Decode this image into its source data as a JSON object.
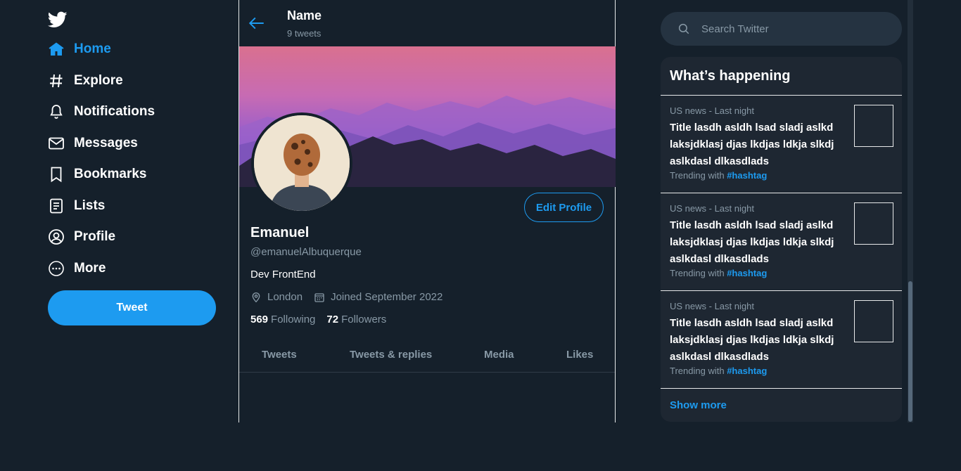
{
  "nav": {
    "items": [
      {
        "label": "Home",
        "icon": "home-icon"
      },
      {
        "label": "Explore",
        "icon": "hashtag-icon"
      },
      {
        "label": "Notifications",
        "icon": "bell-icon"
      },
      {
        "label": "Messages",
        "icon": "envelope-icon"
      },
      {
        "label": "Bookmarks",
        "icon": "bookmark-icon"
      },
      {
        "label": "Lists",
        "icon": "list-icon"
      },
      {
        "label": "Profile",
        "icon": "user-icon"
      },
      {
        "label": "More",
        "icon": "more-icon"
      }
    ],
    "tweet_button": "Tweet"
  },
  "header": {
    "name": "Name",
    "tweet_count": "9 tweets"
  },
  "profile": {
    "display_name": "Emanuel",
    "handle": "@emanuelAlbuquerque",
    "bio": "Dev FrontEnd",
    "location": "London",
    "joined": "Joined September 2022",
    "following_count": "569",
    "following_label": "Following",
    "followers_count": "72",
    "followers_label": "Followers",
    "edit_button": "Edit Profile"
  },
  "tabs": [
    "Tweets",
    "Tweets & replies",
    "Media",
    "Likes"
  ],
  "search": {
    "placeholder": "Search Twitter"
  },
  "trends": {
    "title": "What’s happening",
    "items": [
      {
        "meta": "US news - Last night",
        "title": "Title lasdh asldh lsad sladj aslkd laksjdklasj djas lkdjas ldkja slkdj aslkdasl dlkasdlads",
        "trending_with": "Trending with",
        "hashtag": "#hashtag"
      },
      {
        "meta": "US news - Last night",
        "title": "Title lasdh asldh lsad sladj aslkd laksjdklasj djas lkdjas ldkja slkdj aslkdasl dlkasdlads",
        "trending_with": "Trending with",
        "hashtag": "#hashtag"
      },
      {
        "meta": "US news - Last night",
        "title": "Title lasdh asldh lsad sladj aslkd laksjdklasj djas lkdjas ldkja slkdj aslkdasl dlkasdlads",
        "trending_with": "Trending with",
        "hashtag": "#hashtag"
      }
    ],
    "show_more": "Show more"
  },
  "colors": {
    "background": "#15202b",
    "accent": "#1d9bf0",
    "muted_text": "#8899a6",
    "card": "#1e2732"
  }
}
